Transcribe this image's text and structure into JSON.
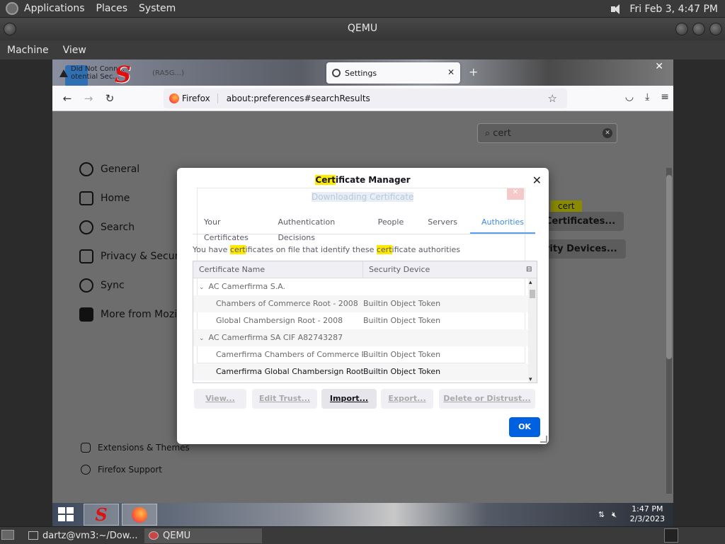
{
  "top_panel": {
    "menus": [
      "Applications",
      "Places",
      "System"
    ],
    "clock": "Fri Feb  3,  4:47 PM"
  },
  "qemu": {
    "title": "QEMU",
    "menu": [
      "Machine",
      "View"
    ]
  },
  "browser": {
    "tabs": [
      {
        "label": "Did Not Conn... otential Sec...",
        "extra": "(RA5G...)"
      },
      {
        "label": "Settings"
      }
    ],
    "identity_label": "Firefox",
    "url": "about:preferences#searchResults"
  },
  "settings": {
    "search_value": "cert",
    "sidebar": [
      {
        "label": "General",
        "icon": "gear-icon"
      },
      {
        "label": "Home",
        "icon": "home-icon"
      },
      {
        "label": "Search",
        "icon": "search-icon"
      },
      {
        "label": "Privacy & Security",
        "icon": "lock-icon"
      },
      {
        "label": "Sync",
        "icon": "sync-icon"
      },
      {
        "label": "More from Mozilla",
        "icon": "mozilla-icon"
      }
    ],
    "footer_links": [
      {
        "label": "Extensions & Themes",
        "icon": "puzzle-icon"
      },
      {
        "label": "Firefox Support",
        "icon": "help-icon"
      }
    ],
    "bg_highlight": "cert",
    "bg_buttons": [
      "Certificates...",
      "rity Devices..."
    ]
  },
  "cert_manager": {
    "title_highlight": "Cert",
    "title_rest": "ificate Manager",
    "ghost_title": "Downloading Certificate",
    "tabs": [
      "Your Certificates",
      "Authentication Decisions",
      "People",
      "Servers",
      "Authorities"
    ],
    "selected_tab": "Authorities",
    "desc_parts": [
      "You have ",
      "cert",
      "ificates on file that identify these ",
      "cert",
      "ificate authorities"
    ],
    "columns": [
      "Certificate Name",
      "Security Device"
    ],
    "rows": [
      {
        "name": "AC Camerfirma S.A.",
        "device": "",
        "type": "parent"
      },
      {
        "name": "Chambers of Commerce Root - 2008",
        "device": "Builtin Object Token",
        "type": "child"
      },
      {
        "name": "Global Chambersign Root - 2008",
        "device": "Builtin Object Token",
        "type": "child"
      },
      {
        "name": "AC Camerfirma SA CIF A82743287",
        "device": "",
        "type": "parent"
      },
      {
        "name": "Camerfirma Chambers of Commerce Root",
        "device": "Builtin Object Token",
        "type": "child"
      },
      {
        "name": "Camerfirma Global Chambersign Root",
        "device": "Builtin Object Token",
        "type": "child-strong"
      }
    ],
    "buttons": {
      "view": "View...",
      "edit": "Edit Trust...",
      "import": "Import...",
      "export": "Export...",
      "delete": "Delete or Distrust..."
    },
    "ok": "OK"
  },
  "guest_taskbar": {
    "time": "1:47 PM",
    "date": "2/3/2023"
  },
  "bottom_panel": {
    "tasks": [
      "dartz@vm3:~/Dow...",
      "QEMU"
    ]
  }
}
